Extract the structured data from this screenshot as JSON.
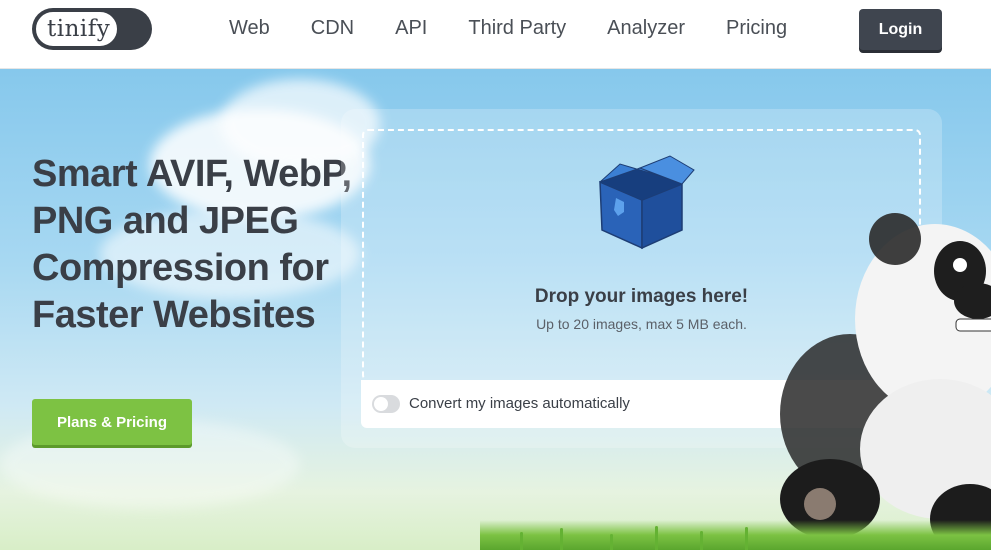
{
  "header": {
    "logo_text": "tinify",
    "nav": [
      "Web",
      "CDN",
      "API",
      "Third Party",
      "Analyzer",
      "Pricing"
    ],
    "login_label": "Login"
  },
  "hero": {
    "headline": "Smart AVIF, WebP, PNG and JPEG Compression for Faster Websites",
    "plans_button": "Plans & Pricing"
  },
  "dropzone": {
    "title": "Drop your images here!",
    "subtitle": "Up to 20 images, max 5 MB each.",
    "convert_label": "Convert my images automatically",
    "convert_enabled": false
  },
  "colors": {
    "accent_green": "#7dc243",
    "dark": "#3a3f47",
    "sky": "#86c8ec"
  }
}
